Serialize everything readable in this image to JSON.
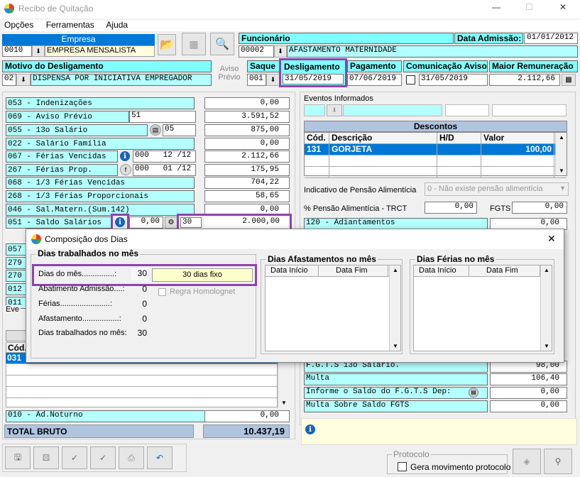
{
  "window": {
    "title": "Recibo de Quitação",
    "min": "—",
    "max": "☐",
    "close": "✕"
  },
  "menu": [
    "Opções",
    "Ferramentas",
    "Ajuda"
  ],
  "empresa": {
    "label": "Empresa",
    "code": "0010",
    "name": "EMPRESA MENSALISTA"
  },
  "funcionario": {
    "label": "Funcionário",
    "code": "00002",
    "name": "AFASTAMENTO MATERNIDADE",
    "admissao_label": "Data Admissão:",
    "admissao": "01/01/2012"
  },
  "motivo": {
    "label": "Motivo do Desligamento",
    "code": "02",
    "text": "DISPENSA POR INICIATIVA EMPREGADOR"
  },
  "aviso_previo": "Aviso\nPrévio",
  "saque": {
    "label": "Saque",
    "code": "001"
  },
  "desligamento": {
    "label": "Desligamento",
    "date": "31/05/2019"
  },
  "pagamento": {
    "label": "Pagamento",
    "date": "07/06/2019"
  },
  "comunicacao": {
    "label": "Comunicação Aviso",
    "date": "31/05/2019"
  },
  "maior_rem": {
    "label": "Maior Remuneração",
    "value": "2.112,66"
  },
  "verbas": [
    {
      "label": "053 - Indenizações",
      "extra": "",
      "value": "0,00"
    },
    {
      "label": "069 - Aviso Prévio",
      "extra": "51",
      "value": "3.591,52"
    },
    {
      "label": "055 - 13o Salário",
      "extra": "05",
      "value": "875,00"
    },
    {
      "label": "022 - Salário Família",
      "extra": "",
      "value": "0,00"
    },
    {
      "label": "067 - Férias Vencidas",
      "extra": "000   12 /12",
      "value": "2.112,66"
    },
    {
      "label": "267 - Férias Prop.",
      "extra": "000   01 /12",
      "value": "175,95"
    },
    {
      "label": "068 - 1/3 Férias Vencidas",
      "extra": "",
      "value": "704,22"
    },
    {
      "label": "268 - 1/3 Férias Proporcionais",
      "extra": "",
      "value": "58,65"
    },
    {
      "label": "046 - Sal.Matern.(Sum.142)",
      "extra": "",
      "value": "0,00"
    },
    {
      "label": "051 - Saldo Salários",
      "extra": "0,00",
      "value": "2.000,00"
    }
  ],
  "saldo_dias": "30",
  "partial_codes": [
    "057",
    "279",
    "270",
    "012",
    "011"
  ],
  "eventos_label": "Eve",
  "cod_label": "Cód.",
  "row031": "031",
  "ad_noturno": {
    "label": "010 - Ad.Noturno",
    "value": "0,00"
  },
  "total_bruto": {
    "label": "TOTAL BRUTO",
    "value": "10.437,19"
  },
  "eventos_informados": "Eventos Informados",
  "descontos": {
    "title": "Descontos",
    "cols": [
      "Cód.",
      "Descrição",
      "H/D",
      "Valor"
    ],
    "rows": [
      {
        "cod": "131",
        "desc": "GORJETA",
        "hd": "",
        "valor": "100,00"
      }
    ]
  },
  "pensao": {
    "label": "Indicativo de Pensão Alimentícia",
    "value": "0 - Não existe pensão alimentícia"
  },
  "pensao_trct": {
    "label": "% Pensão Alimentícia - TRCT",
    "value": "0,00",
    "fgts_label": "FGTS",
    "fgts": "0,00"
  },
  "adiantamentos": {
    "label": "120 - Adiantamentos",
    "value": "0,00"
  },
  "right_lower": [
    {
      "label": "F.G.T.S  13o Salário.",
      "value": "98,00"
    },
    {
      "label": "Multa",
      "value": "106,40"
    },
    {
      "label": "Informe o Saldo do F.G.T.S Dep:",
      "value": "0,00"
    },
    {
      "label": "Multa Sobre Saldo FGTS",
      "value": "0,00"
    }
  ],
  "protocolo": {
    "label": "Protocolo",
    "check": "Gera movimento protocolo"
  },
  "dialog": {
    "title": "Composição dos Dias",
    "close": "✕",
    "group1": "Dias trabalhados no mês",
    "dias_mes_label": "Dias do mês...............:",
    "dias_mes": "30",
    "dias_fixo": "30 dias fixo",
    "abatimento_label": "Abatimento Admissão....:",
    "abatimento": "0",
    "regra": "Regra Homolognet",
    "ferias_label": "Férias.......................:",
    "ferias": "0",
    "afast_label": "Afastamento.................:",
    "afast": "0",
    "trab_label": "Dias trabalhados no mês:",
    "trab": "30",
    "group2": "Dias Afastamentos no mês",
    "group3": "Dias Férias no mês",
    "col_inicio": "Data Início",
    "col_fim": "Data Fim"
  }
}
